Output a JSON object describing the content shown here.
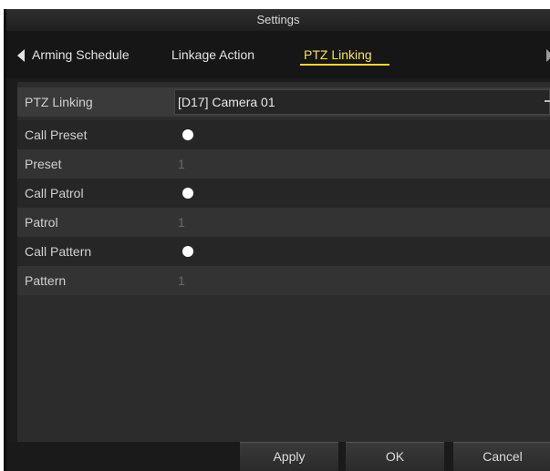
{
  "window": {
    "title": "Settings"
  },
  "tabs": [
    {
      "label": "Arming Schedule",
      "active": false
    },
    {
      "label": "Linkage Action",
      "active": false
    },
    {
      "label": "PTZ Linking",
      "active": true
    }
  ],
  "icons": {
    "prev": "chevron-left-icon",
    "next": "chevron-right-icon",
    "select": "dropdown-indicator-icon",
    "radio": "radio-on-icon"
  },
  "colors": {
    "active_tab": "#f4e44b",
    "background": "#1c1c1c",
    "panel": "#2c2c2c"
  },
  "form": {
    "rows": [
      {
        "label": "PTZ Linking",
        "value": "[D17] Camera 01"
      },
      {
        "label": "Call Preset",
        "value": ""
      },
      {
        "label": "Preset",
        "value": "1"
      },
      {
        "label": "Call Patrol",
        "value": ""
      },
      {
        "label": "Patrol",
        "value": "1"
      },
      {
        "label": "Call Pattern",
        "value": ""
      },
      {
        "label": "Pattern",
        "value": "1"
      }
    ]
  },
  "buttons": {
    "apply": "Apply",
    "ok": "OK",
    "cancel": "Cancel"
  }
}
